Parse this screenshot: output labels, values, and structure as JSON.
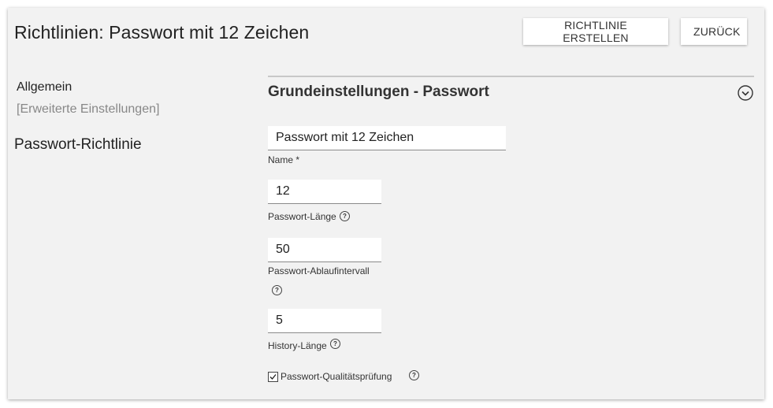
{
  "header": {
    "title": "Richtlinien: Passwort mit 12 Zeichen",
    "create_button": "RICHTLINIE ERSTELLEN",
    "back_button": "ZURÜCK"
  },
  "nav": {
    "general": "Allgemein",
    "advanced": "[Erweiterte Einstellungen]",
    "section": "Passwort-Richtlinie"
  },
  "section": {
    "title": "Grundeinstellungen - Passwort"
  },
  "fields": {
    "name": {
      "value": "Passwort mit 12 Zeichen",
      "label": "Name *"
    },
    "length": {
      "value": "12",
      "label": "Passwort-Länge"
    },
    "expiry": {
      "value": "50",
      "label": "Passwort-Ablaufintervall"
    },
    "history": {
      "value": "5",
      "label": "History-Länge"
    },
    "quality": {
      "checked": true,
      "label": "Passwort-Qualitätsprüfung"
    }
  },
  "icons": {
    "help": "help-circle-icon",
    "collapse": "chevron-down-circle-icon"
  },
  "help_glyph": "?"
}
